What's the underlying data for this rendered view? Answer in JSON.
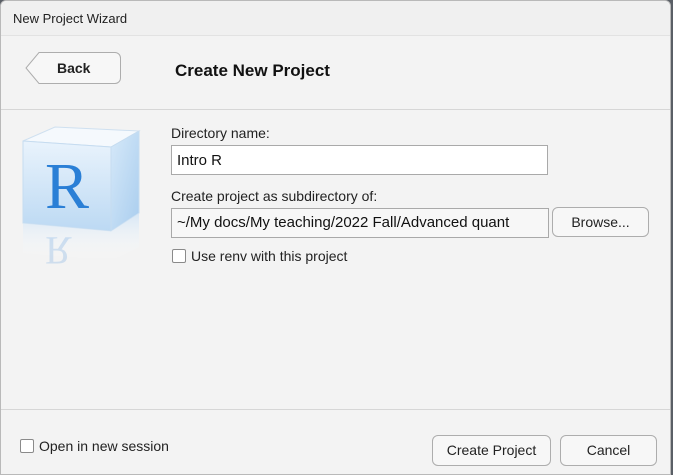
{
  "window": {
    "title": "New Project Wizard"
  },
  "header": {
    "back_label": "Back",
    "page_title": "Create New Project"
  },
  "form": {
    "dir_name_label": "Directory name:",
    "dir_name_value": "Intro R",
    "subdir_label": "Create project as subdirectory of:",
    "subdir_value": "~/My docs/My teaching/2022 Fall/Advanced quant",
    "browse_label": "Browse...",
    "renv_label": "Use renv with this project",
    "renv_checked": false
  },
  "footer": {
    "new_session_label": "Open in new session",
    "new_session_checked": false,
    "create_label": "Create Project",
    "cancel_label": "Cancel"
  },
  "colors": {
    "logo_blue": "#2a7fd6",
    "window_bg": "#f3f3f3"
  },
  "icons": {
    "logo": "r-logo-icon",
    "back": "back-arrow-icon"
  }
}
